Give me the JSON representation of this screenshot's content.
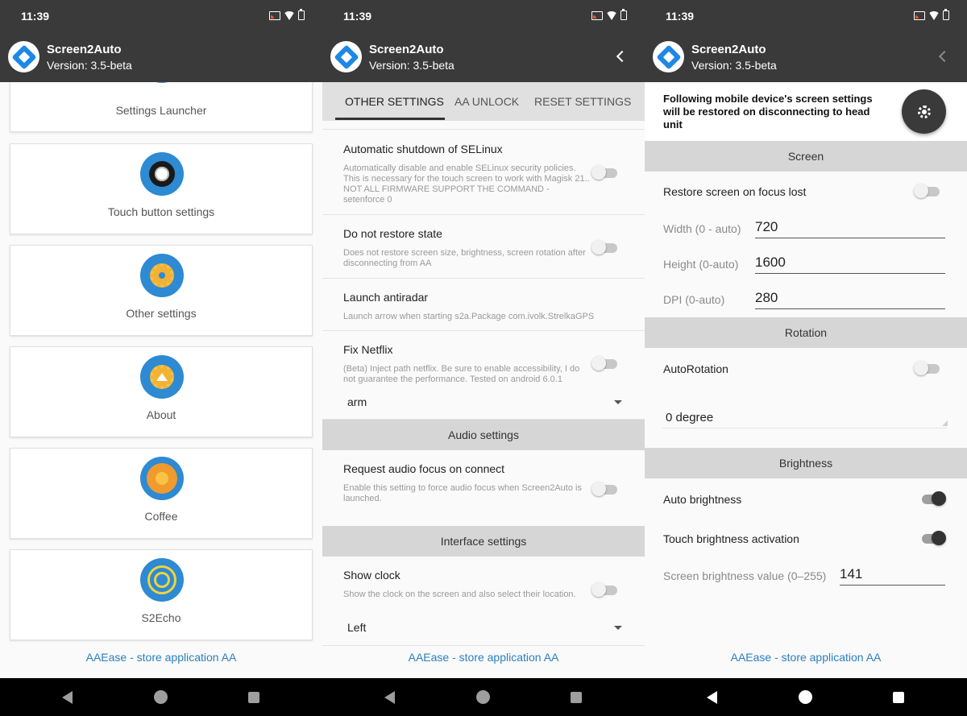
{
  "status": {
    "time": "11:39"
  },
  "app": {
    "title": "Screen2Auto",
    "version": "Version: 3.5-beta"
  },
  "footer": {
    "link": "AAEase - store application AA"
  },
  "screen1": {
    "cards": [
      {
        "label": "Settings Launcher",
        "icon": "launcher-icon"
      },
      {
        "label": "Touch button settings",
        "icon": "touch-button-icon"
      },
      {
        "label": "Other settings",
        "icon": "gear-icon"
      },
      {
        "label": "About",
        "icon": "about-icon"
      },
      {
        "label": "Coffee",
        "icon": "coffee-icon"
      },
      {
        "label": "S2Echo",
        "icon": "echo-icon"
      }
    ]
  },
  "screen2": {
    "tabs": [
      "OTHER SETTINGS",
      "AA UNLOCK",
      "RESET SETTINGS"
    ],
    "prefs": {
      "selinux": {
        "title": "Automatic shutdown of SELinux",
        "summary": "Automatically disable and enable SELinux security policies. This is necessary for the touch screen to work with Magisk 21.. NOT ALL FIRMWARE SUPPORT THE COMMAND - setenforce 0",
        "on": false
      },
      "restore": {
        "title": "Do not restore state",
        "summary": "Does not restore screen size, brightness, screen rotation after disconnecting from AA",
        "on": false
      },
      "antiradar": {
        "title": "Launch antiradar",
        "summary": "Launch arrow when starting s2a.Package com.ivolk.StrelkaGPS"
      },
      "netflix": {
        "title": "Fix Netflix",
        "summary": "(Beta) Inject path netflix. Be sure to enable accessibility, I do not guarantee the performance. Tested on android 6.0.1",
        "on": false,
        "select": "arm"
      },
      "audio_header": "Audio settings",
      "audio_focus": {
        "title": "Request audio focus on connect",
        "summary": "Enable this setting to force audio focus when Screen2Auto is launched.",
        "on": false
      },
      "interface_header": "Interface settings",
      "clock": {
        "title": "Show clock",
        "summary": "Show the clock on the screen and also select their location.",
        "on": false,
        "select": "Left"
      }
    }
  },
  "screen3": {
    "notice": "Following mobile device's screen settings will be restored on disconnecting to head unit",
    "screen_header": "Screen",
    "restore_focus": {
      "title": "Restore screen on focus lost",
      "on": false
    },
    "width": {
      "label": "Width (0 - auto)",
      "value": "720"
    },
    "height": {
      "label": "Height (0-auto)",
      "value": "1600"
    },
    "dpi": {
      "label": "DPI (0-auto)",
      "value": "280"
    },
    "rotation_header": "Rotation",
    "autorotation": {
      "title": "AutoRotation",
      "on": false
    },
    "degree": "0 degree",
    "brightness_header": "Brightness",
    "auto_brightness": {
      "title": "Auto brightness",
      "on": true
    },
    "touch_brightness": {
      "title": "Touch brightness activation",
      "on": true
    },
    "brightness_value": {
      "label": "Screen brightness value (0–255)",
      "value": "141"
    }
  }
}
